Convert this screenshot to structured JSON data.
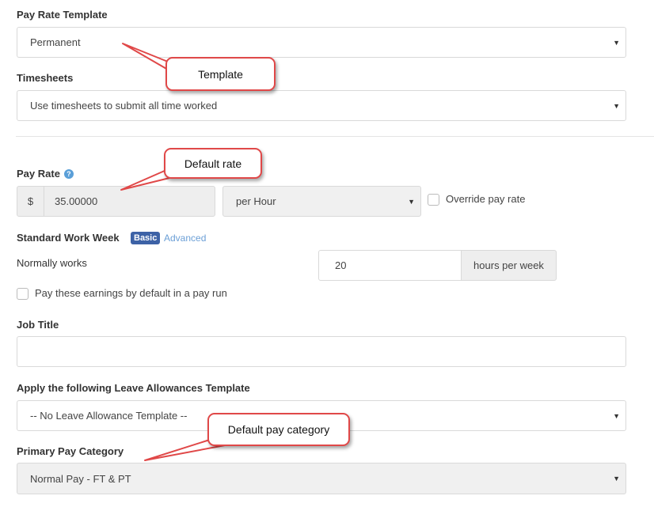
{
  "pay_rate_template": {
    "label": "Pay Rate Template",
    "value": "Permanent"
  },
  "timesheets": {
    "label": "Timesheets",
    "value": "Use timesheets to submit all time worked"
  },
  "pay_rate": {
    "label": "Pay Rate",
    "currency": "$",
    "amount": "35.00000",
    "unit": "per Hour",
    "override_label": "Override pay rate"
  },
  "standard_work_week": {
    "label": "Standard Work Week",
    "basic": "Basic",
    "advanced": "Advanced",
    "normally_works": "Normally works",
    "hours": "20",
    "hours_unit": "hours per week"
  },
  "pay_by_default_label": "Pay these earnings by default in a pay run",
  "job_title": {
    "label": "Job Title",
    "value": ""
  },
  "leave_template": {
    "label": "Apply the following Leave Allowances Template",
    "value": "-- No Leave Allowance Template --"
  },
  "primary_pay_category": {
    "label": "Primary Pay Category",
    "value": "Normal Pay - FT & PT"
  },
  "callouts": {
    "template": "Template",
    "default_rate": "Default rate",
    "default_pay_category": "Default pay category"
  },
  "colors": {
    "callout_border": "#e04848",
    "badge": "#3d62a6",
    "link": "#6b9fd6"
  }
}
